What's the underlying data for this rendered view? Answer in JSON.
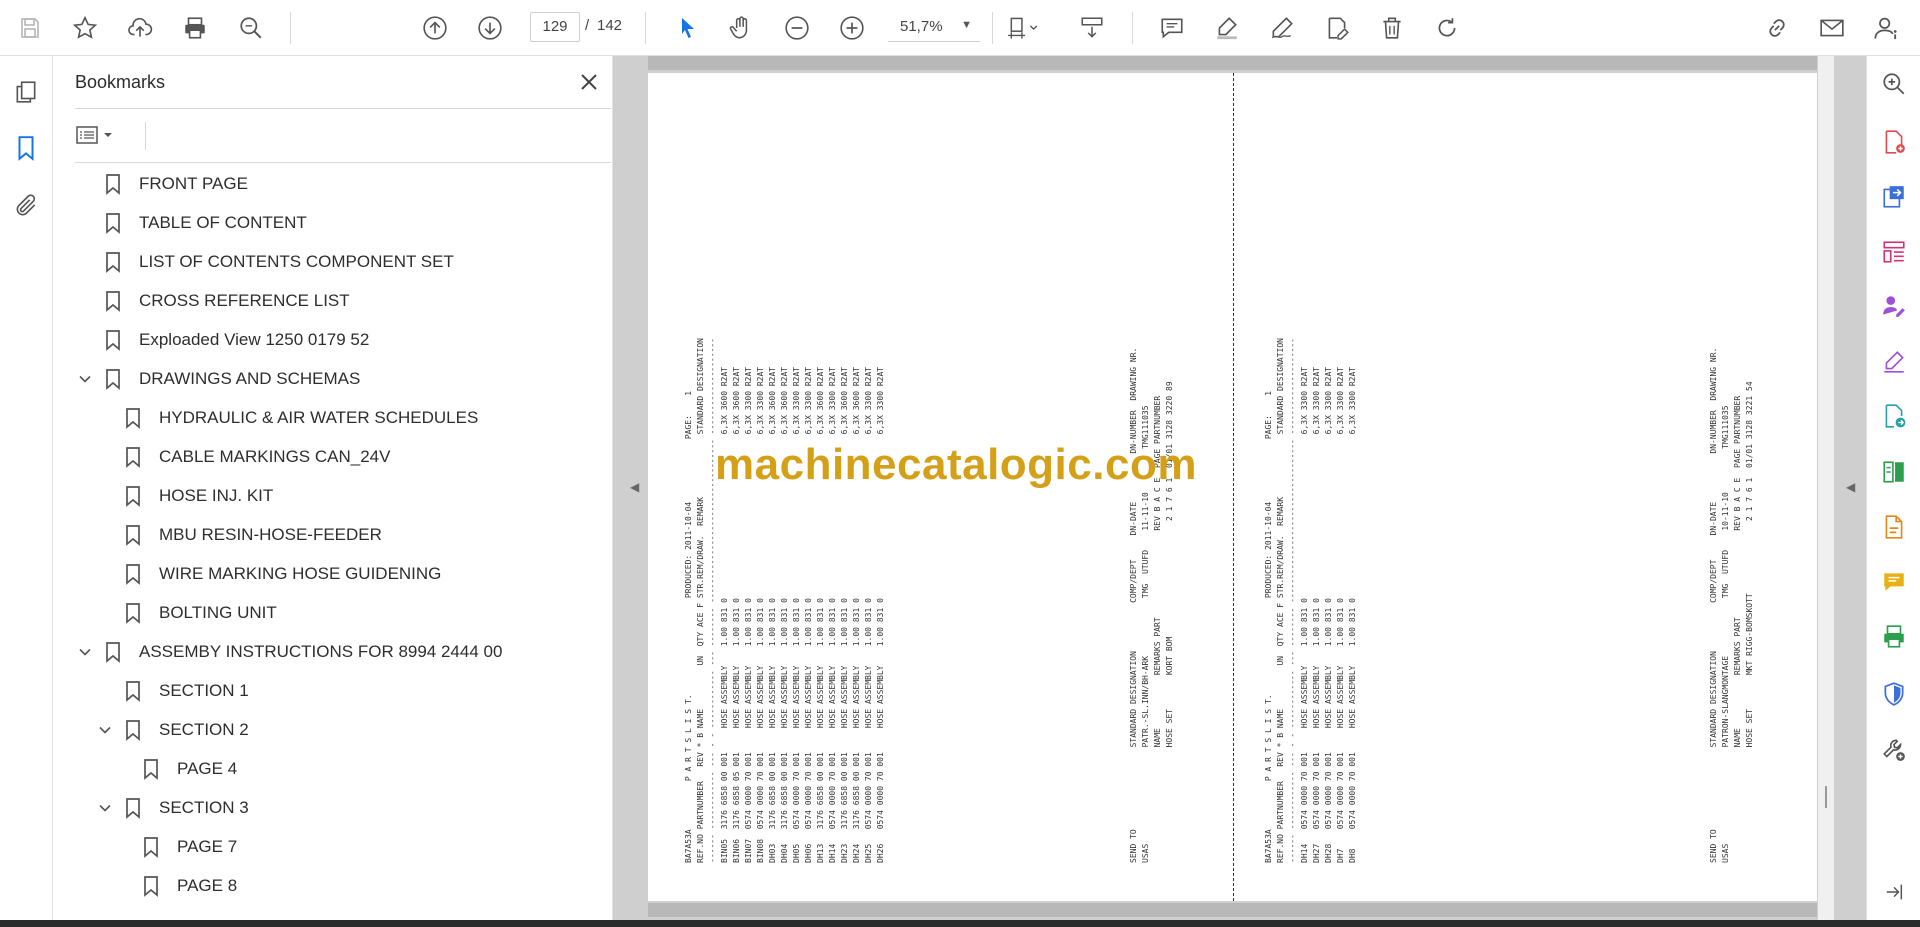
{
  "toolbar": {
    "page_current": "129",
    "page_separator": "/",
    "page_total": "142",
    "zoom": "51,7%",
    "accent": "#1473e6"
  },
  "bookmarks": {
    "title": "Bookmarks",
    "items": [
      {
        "label": "FRONT PAGE",
        "level": 0,
        "expand": "none"
      },
      {
        "label": "TABLE OF CONTENT",
        "level": 0,
        "expand": "none"
      },
      {
        "label": "LIST OF CONTENTS COMPONENT SET",
        "level": 0,
        "expand": "none"
      },
      {
        "label": "CROSS REFERENCE LIST",
        "level": 0,
        "expand": "none"
      },
      {
        "label": "Exploaded View 1250 0179 52",
        "level": 0,
        "expand": "none"
      },
      {
        "label": "DRAWINGS AND SCHEMAS",
        "level": 0,
        "expand": "open"
      },
      {
        "label": "HYDRAULIC & AIR WATER SCHEDULES",
        "level": 1,
        "expand": "none"
      },
      {
        "label": "CABLE MARKINGS CAN_24V",
        "level": 1,
        "expand": "none"
      },
      {
        "label": "HOSE INJ. KIT",
        "level": 1,
        "expand": "none"
      },
      {
        "label": "MBU RESIN-HOSE-FEEDER",
        "level": 1,
        "expand": "none"
      },
      {
        "label": "WIRE MARKING HOSE GUIDENING",
        "level": 1,
        "expand": "none"
      },
      {
        "label": "BOLTING UNIT",
        "level": 1,
        "expand": "none"
      },
      {
        "label": "ASSEMBY INSTRUCTIONS FOR 8994 2444 00",
        "level": 0,
        "expand": "open"
      },
      {
        "label": "SECTION 1",
        "level": 1,
        "expand": "none"
      },
      {
        "label": "SECTION 2",
        "level": 1,
        "expand": "open"
      },
      {
        "label": "PAGE 4",
        "level": 2,
        "expand": "none"
      },
      {
        "label": "SECTION 3",
        "level": 1,
        "expand": "open"
      },
      {
        "label": "PAGE 7",
        "level": 2,
        "expand": "none"
      },
      {
        "label": "PAGE 8",
        "level": 2,
        "expand": "none"
      }
    ]
  },
  "document": {
    "watermark": "machinecatalogic.com",
    "left_sheet": {
      "lines": [
        "BA7A53A          P A R T S L I S T.                    PRODUCED: 2011-10-04             PAGE:    1",
        "",
        "REF.NO PARTNUMBER   REV * B NAME         UN  QTY ACE F STR.REM/DRAW.  REMARK             STANDARD DESIGNATION",
        "------ ------------ --- - - ------------ --- -------- ---------------------------------- --------------------",
        "BIN05  3176 6858 00 001     HOSE ASSEMBLY    1.00 831 0                                  6,3X 3600 R2AT",
        "BIN06  3176 6858 05 001     HOSE ASSEMBLY    1.00 831 0                                  6,3X 3600 R2AT",
        "BIN07  0574 0000 70 001     HOSE ASSEMBLY    1.00 831 0                                  6,3X 3300 R2AT",
        "BIN08  0574 0000 70 001     HOSE ASSEMBLY    1.00 831 0                                  6,3X 3300 R2AT",
        "DH03   3176 6858 00 001     HOSE ASSEMBLY    1.00 831 0                                  6,3X 3600 R2AT",
        "DH04   3176 6858 00 001     HOSE ASSEMBLY    1.00 831 0                                  6,3X 3600 R2AT",
        "DH05   0574 0000 70 001     HOSE ASSEMBLY    1.00 831 0                                  6,3X 3300 R2AT",
        "DH06   0574 0000 70 001     HOSE ASSEMBLY    1.00 831 0                                  6,3X 3300 R2AT",
        "DH13   3176 6858 00 001     HOSE ASSEMBLY    1.00 831 0                                  6,3X 3600 R2AT",
        "DH14   0574 0000 70 001     HOSE ASSEMBLY    1.00 831 0                                  6,3X 3300 R2AT",
        "DH23   3176 6858 00 001     HOSE ASSEMBLY    1.00 831 0                                  6,3X 3600 R2AT",
        "DH24   3176 6858 00 001     HOSE ASSEMBLY    1.00 831 0                                  6,3X 3600 R2AT",
        "DH25   0574 0000 70 001     HOSE ASSEMBLY    1.00 831 0                                  6,3X 3300 R2AT",
        "DH26   0574 0000 70 001     HOSE ASSEMBLY    1.00 831 0                                  6,3X 3300 R2AT"
      ],
      "footer": [
        "SEND TO                 STANDARD DESIGNATION          COMP/DEPT     DN-DATE          DN-NUMBER  DRAWING NR.",
        "USAS                    PATR.-SL.INN/BH-ARK            TMG  UTUFD    11-11-10         TMG111035",
        "                        NAME           REMARKS PART                  REV B A C E  PAGE PARTNUMBER",
        "                        HOSE SET       KORT BOM                        2 1 7 6 1  01/01 3128 3220 89"
      ]
    },
    "right_sheet": {
      "lines": [
        "BA7A53A          P A R T S L I S T.                    PRODUCED: 2011-10-04             PAGE:    1",
        "",
        "REF.NO PARTNUMBER   REV * B NAME         UN  QTY ACE F STR.REM/DRAW.  REMARK             STANDARD DESIGNATION",
        "------ ------------ --- - - ------------ --- -------- ---------------------------------- --------------------",
        "DH14   0574 0000 70 001     HOSE ASSEMBLY    1.00 831 0                                  6,3X 3300 R2AT",
        "DH27   0574 0000 70 001     HOSE ASSEMBLY    1.00 831 0                                  6,3X 3300 R2AT",
        "DH28   0574 0000 70 001     HOSE ASSEMBLY    1.00 831 0                                  6,3X 3300 R2AT",
        "DH7    0574 0000 70 001     HOSE ASSEMBLY    1.00 831 0                                  6,3X 3300 R2AT",
        "DH8    0574 0000 70 001     HOSE ASSEMBLY    1.00 831 0                                  6,3X 3300 R2AT"
      ],
      "footer": [
        "SEND TO                 STANDARD DESIGNATION          COMP/DEPT     DN-DATE          DN-NUMBER  DRAWING NR.",
        "USAS                    PATRON-SLANGMONTAGE            TMG  UTUFD    10-11-10         TMG111035",
        "                        NAME           REMARKS PART                  REV B A C E  PAGE PARTNUMBER",
        "                        HOSE SET       MKT RIGG-BOMSKOTT               2 1 7 6 1  01/01 3128 3221 54"
      ]
    }
  }
}
